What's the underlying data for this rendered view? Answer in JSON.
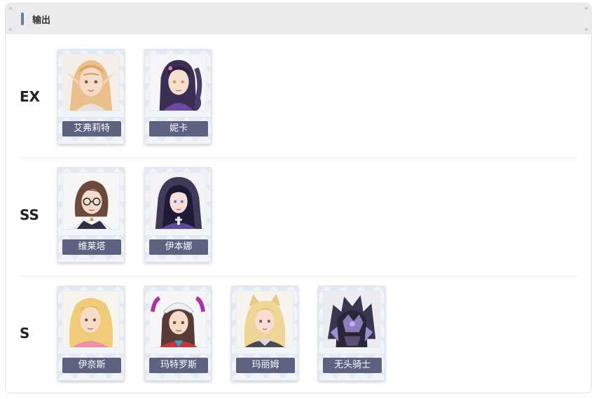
{
  "panel": {
    "title": "输出",
    "accent_color": "#6b7aa1",
    "name_tag_color": "#5c6280"
  },
  "tiers": [
    {
      "label": "EX",
      "characters": [
        {
          "name": "艾弗莉特",
          "portrait": "elf-blonde-portrait"
        },
        {
          "name": "妮卡",
          "portrait": "dark-twin-braid-portrait"
        }
      ]
    },
    {
      "label": "SS",
      "characters": [
        {
          "name": "维莱塔",
          "portrait": "glasses-brunette-portrait"
        },
        {
          "name": "伊本娜",
          "portrait": "hooded-purple-portrait"
        }
      ]
    },
    {
      "label": "S",
      "characters": [
        {
          "name": "伊奈斯",
          "portrait": "blonde-pink-portrait"
        },
        {
          "name": "玛特罗斯",
          "portrait": "white-cap-portrait"
        },
        {
          "name": "玛丽姆",
          "portrait": "cat-ear-blonde-portrait"
        },
        {
          "name": "无头骑士",
          "portrait": "armored-knight-portrait"
        }
      ]
    }
  ]
}
